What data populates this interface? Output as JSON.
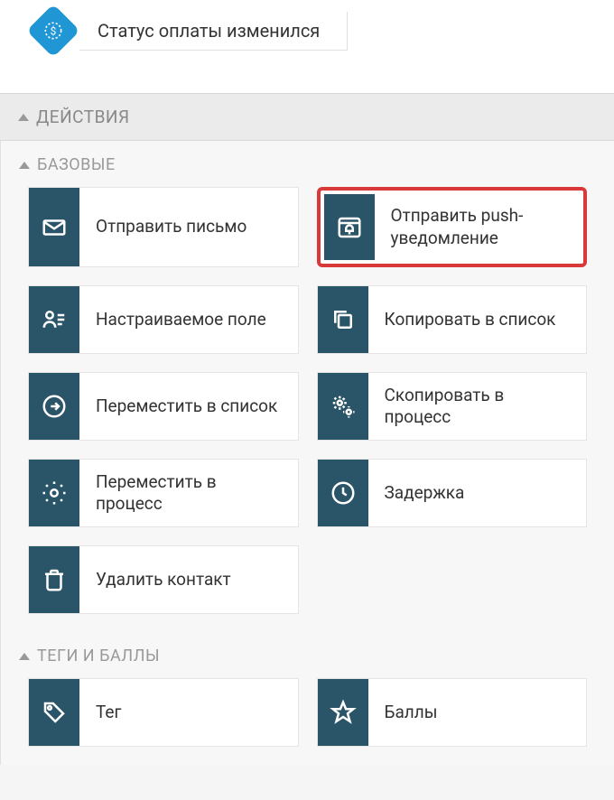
{
  "trigger": {
    "payment_status_changed": "Статус оплаты изменился"
  },
  "sections": {
    "actions": {
      "title": "ДЕЙСТВИЯ",
      "basic": {
        "title": "БАЗОВЫЕ",
        "send_email": "Отправить письмо",
        "send_push": "Отправить push-уведомление",
        "custom_field": "Настраиваемое поле",
        "copy_to_list": "Копировать в список",
        "move_to_list": "Переместить в список",
        "copy_to_process": "Скопировать в процесс",
        "move_to_process": "Переместить в процесс",
        "delay": "Задержка",
        "delete_contact": "Удалить контакт"
      },
      "tags_and_scores": {
        "title": "ТЕГИ И БАЛЛЫ",
        "tag": "Тег",
        "scores": "Баллы"
      }
    }
  }
}
